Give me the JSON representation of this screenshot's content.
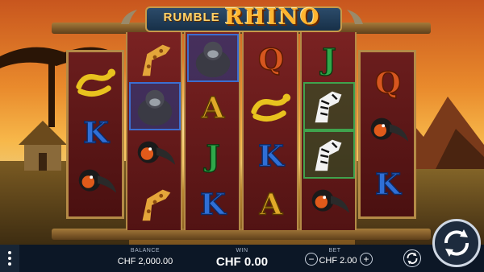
{
  "logo": {
    "small_word": "RUMBLE",
    "big_word": "RHINO"
  },
  "reels": [
    [
      "yellow-snake",
      "letter-k",
      "hornbill-bird"
    ],
    [
      "giraffe",
      "gorilla",
      "hornbill-bird",
      "giraffe"
    ],
    [
      "gorilla",
      "letter-a",
      "letter-j",
      "letter-k"
    ],
    [
      "letter-q",
      "yellow-snake",
      "letter-k",
      "letter-a"
    ],
    [
      "letter-j",
      "zebra",
      "zebra",
      "hornbill-bird"
    ],
    [
      "letter-q",
      "hornbill-bird",
      "letter-k"
    ]
  ],
  "footer": {
    "balance_label": "BALANCE",
    "balance_value": "CHF 2,000.00",
    "win_label": "WIN",
    "win_value": "CHF 0.00",
    "bet_label": "BET",
    "bet_value": "CHF 2.00",
    "minus_symbol": "−",
    "plus_symbol": "+"
  },
  "colors": {
    "reel_bg": "#6b1d1d",
    "frame_gold": "#b48a46",
    "bar_bg": "#0c1726",
    "letter_blue": "#2f6fd6",
    "letter_gold": "#e0a928",
    "letter_green": "#2fa84a",
    "letter_orange": "#d6561f"
  }
}
